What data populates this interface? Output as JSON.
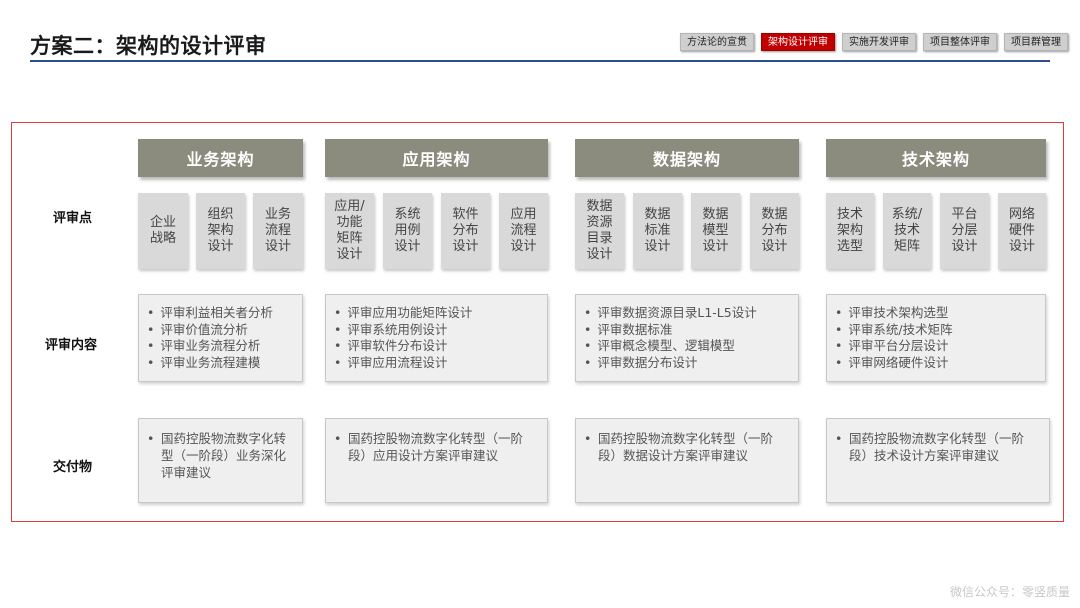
{
  "header": {
    "title": "方案二：架构的设计评审",
    "tabs": [
      {
        "label": "方法论的宣贯",
        "active": false
      },
      {
        "label": "架构设计评审",
        "active": true
      },
      {
        "label": "实施开发评审",
        "active": false
      },
      {
        "label": "项目整体评审",
        "active": false
      },
      {
        "label": "项目群管理",
        "active": false
      }
    ]
  },
  "rows": {
    "points": "评审点",
    "content": "评审内容",
    "deliverable": "交付物"
  },
  "columns": [
    {
      "heading": "业务架构",
      "points": [
        "企业\n战略",
        "组织\n架构\n设计",
        "业务\n流程\n设计"
      ],
      "content": [
        "评审利益相关者分析",
        "评审价值流分析",
        "评审业务流程分析",
        "评审业务流程建模"
      ],
      "deliverable": "国药控股物流数字化转型（一阶段）业务深化评审建议"
    },
    {
      "heading": "应用架构",
      "points": [
        "应用/\n功能\n矩阵\n设计",
        "系统\n用例\n设计",
        "软件\n分布\n设计",
        "应用\n流程\n设计"
      ],
      "content": [
        "评审应用功能矩阵设计",
        "评审系统用例设计",
        "评审软件分布设计",
        "评审应用流程设计"
      ],
      "deliverable": "国药控股物流数字化转型（一阶段）应用设计方案评审建议"
    },
    {
      "heading": "数据架构",
      "points": [
        "数据\n资源\n目录\n设计",
        "数据\n标准\n设计",
        "数据\n模型\n设计",
        "数据\n分布\n设计"
      ],
      "content": [
        "评审数据资源目录L1-L5设计",
        "评审数据标准",
        "评审概念模型、逻辑模型",
        "评审数据分布设计"
      ],
      "deliverable": "国药控股物流数字化转型（一阶段）数据设计方案评审建议"
    },
    {
      "heading": "技术架构",
      "points": [
        "技术\n架构\n选型",
        "系统/\n技术\n矩阵",
        "平台\n分层\n设计",
        "网络\n硬件\n设计"
      ],
      "content": [
        "评审技术架构选型",
        "评审系统/技术矩阵",
        "评审平台分层设计",
        "评审网络硬件设计"
      ],
      "deliverable": "国药控股物流数字化转型（一阶段）技术设计方案评审建议"
    }
  ],
  "watermark": "微信公众号：零竖质量"
}
